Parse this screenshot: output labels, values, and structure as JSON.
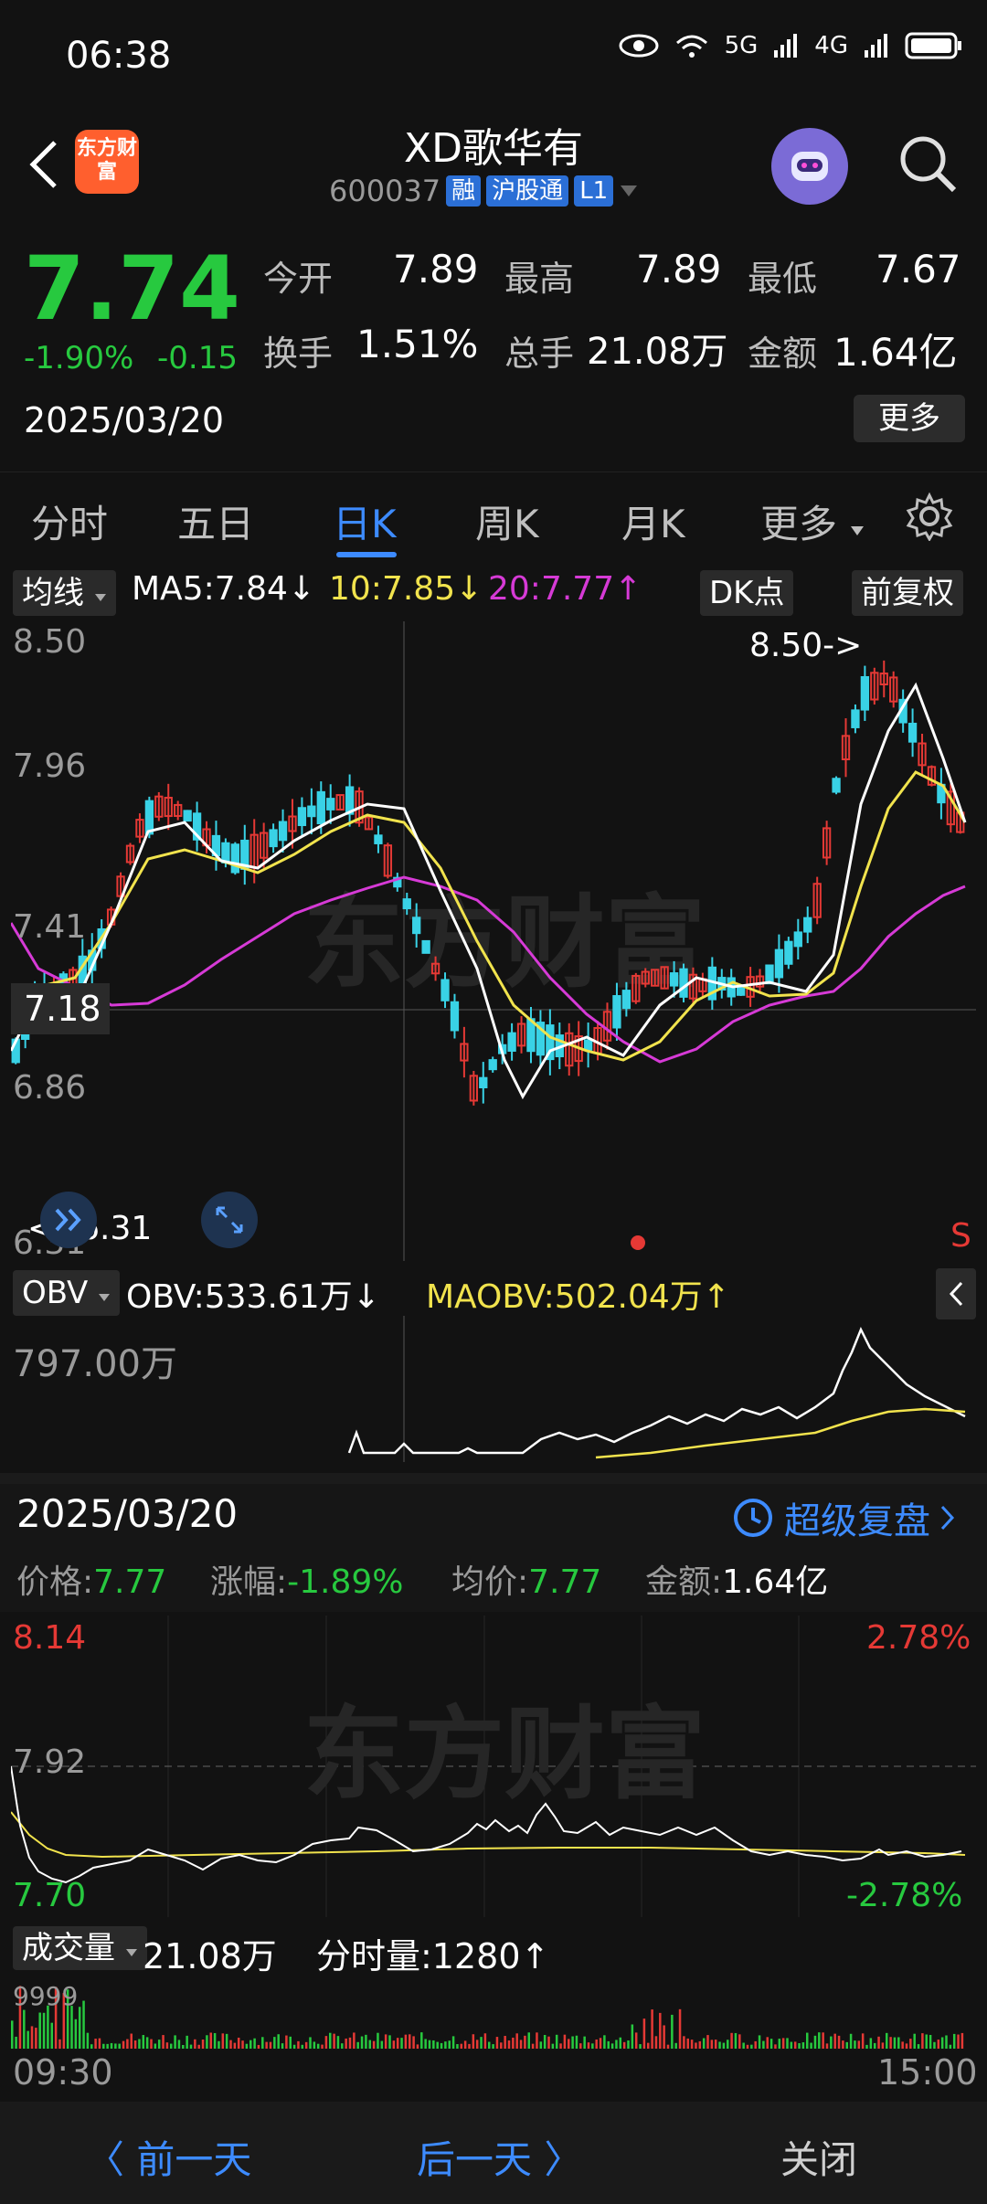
{
  "status": {
    "time": "06:38",
    "net1": "5G",
    "net2": "4G"
  },
  "header": {
    "logo_text": "东方财富",
    "title": "XD歌华有",
    "code": "600037",
    "tags": [
      "融",
      "沪股通",
      "L1"
    ]
  },
  "quote": {
    "price": "7.74",
    "change_pct": "-1.90%",
    "change": "-0.15",
    "date": "2025/03/20",
    "open_label": "今开",
    "open": "7.89",
    "high_label": "最高",
    "high": "7.89",
    "low_label": "最低",
    "low": "7.67",
    "turnover_label": "换手",
    "turnover": "1.51%",
    "volume_label": "总手",
    "volume": "21.08万",
    "amount_label": "金额",
    "amount": "1.64亿",
    "more": "更多"
  },
  "tabs": [
    "分时",
    "五日",
    "日K",
    "周K",
    "月K",
    "更多"
  ],
  "ma_bar": {
    "selector": "均线",
    "ma5": "MA5:7.84",
    "ma10": "10:7.85",
    "ma20": "20:7.77",
    "dk": "DK点",
    "adjust": "前复权"
  },
  "kchart": {
    "y_labels": [
      "8.50",
      "7.96",
      "7.41",
      "6.86",
      "6.31"
    ],
    "crosshair_price": "7.18",
    "max_marker": "8.50->",
    "min_marker": "<--6.31",
    "s_marker": "S",
    "watermark": "东方财富",
    "colors": {
      "up": "#e53935",
      "down": "#39d2e6",
      "ma5": "#ffffff",
      "ma10": "#f1e34d",
      "ma20": "#d63ad6"
    }
  },
  "obv": {
    "selector": "OBV",
    "obv": "OBV:533.61万",
    "maobv": "MAOBV:502.04万",
    "y_label": "797.00万"
  },
  "intraday": {
    "date": "2025/03/20",
    "replay": "超级复盘",
    "price_label": "价格:",
    "price": "7.77",
    "pct_label": "涨幅:",
    "pct": "-1.89%",
    "avg_label": "均价:",
    "avg": "7.77",
    "amount_label": "金额:",
    "amount": "1.64亿",
    "y_top": "8.14",
    "y_mid": "7.92",
    "y_bot": "7.70",
    "pct_top": "2.78%",
    "pct_bot": "-2.78%",
    "vol_selector": "成交量",
    "vol_total": "21.08万",
    "vol_now": "分时量:1280",
    "vol_y": "9999",
    "t_start": "09:30",
    "t_end": "15:00",
    "watermark": "东方财富"
  },
  "bottom": {
    "prev": "前一天",
    "next": "后一天",
    "close": "关闭"
  }
}
